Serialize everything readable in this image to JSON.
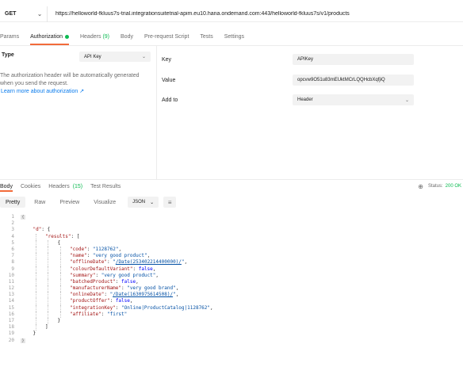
{
  "request": {
    "method": "GET",
    "url": "https://helloworld-fkluus7s-trial.integrationsuitetrial-apim.eu10.hana.ondemand.com:443/helloworld-fkluus7s/v1/products"
  },
  "request_tabs": [
    {
      "label": "Params"
    },
    {
      "label": "Authorization"
    },
    {
      "label": "Headers",
      "count": "(9)"
    },
    {
      "label": "Body"
    },
    {
      "label": "Pre-request Script"
    },
    {
      "label": "Tests"
    },
    {
      "label": "Settings"
    }
  ],
  "auth": {
    "type_label": "Type",
    "type_value": "API Key",
    "description": "The authorization header will be automatically generated when you send the request.",
    "learn_more": "Learn more about authorization ↗",
    "rows": [
      {
        "label": "Key",
        "value": "APIKey"
      },
      {
        "label": "Value",
        "value": "opcvw9O51u83mEUktMCrLQQHcbXqfjiQ"
      },
      {
        "label": "Add to",
        "value": "Header"
      }
    ]
  },
  "response_tabs": [
    {
      "label": "Body"
    },
    {
      "label": "Cookies"
    },
    {
      "label": "Headers",
      "count": "(15)"
    },
    {
      "label": "Test Results"
    }
  ],
  "status": {
    "label": "Status:",
    "value": "200 OK"
  },
  "toolbar": {
    "pretty": "Pretty",
    "raw": "Raw",
    "preview": "Preview",
    "visualize": "Visualize",
    "format": "JSON"
  },
  "icons": {
    "method_chevron": "chevron-down-icon",
    "globe": "globe-icon",
    "wrap": "wrap-lines-icon"
  },
  "colors": {
    "accent": "#f26b3a",
    "success": "#0cbb52",
    "link": "#097bed"
  },
  "code_lines": [
    {
      "n": "1",
      "i": 0,
      "parts": [
        {
          "t": "{",
          "c": "fold"
        }
      ]
    },
    {
      "n": "2",
      "i": 0,
      "parts": []
    },
    {
      "n": "3",
      "i": 1,
      "parts": [
        {
          "t": "\"d\"",
          "c": "k"
        },
        {
          "t": ": {",
          "c": "p"
        }
      ]
    },
    {
      "n": "4",
      "i": 2,
      "parts": [
        {
          "t": "\"results\"",
          "c": "k"
        },
        {
          "t": ": [",
          "c": "p"
        }
      ]
    },
    {
      "n": "5",
      "i": 3,
      "parts": [
        {
          "t": "{",
          "c": "p"
        }
      ]
    },
    {
      "n": "6",
      "i": 4,
      "parts": [
        {
          "t": "\"code\"",
          "c": "k"
        },
        {
          "t": ": ",
          "c": "p"
        },
        {
          "t": "\"1128762\"",
          "c": "s"
        },
        {
          "t": ",",
          "c": "p"
        }
      ]
    },
    {
      "n": "7",
      "i": 4,
      "parts": [
        {
          "t": "\"name\"",
          "c": "k"
        },
        {
          "t": ": ",
          "c": "p"
        },
        {
          "t": "\"very good product\"",
          "c": "s"
        },
        {
          "t": ",",
          "c": "p"
        }
      ]
    },
    {
      "n": "8",
      "i": 4,
      "parts": [
        {
          "t": "\"offlineDate\"",
          "c": "k"
        },
        {
          "t": ": ",
          "c": "p"
        },
        {
          "t": "\"",
          "c": "s"
        },
        {
          "t": "/Date(253402214400000)/",
          "c": "u"
        },
        {
          "t": "\"",
          "c": "s"
        },
        {
          "t": ",",
          "c": "p"
        }
      ]
    },
    {
      "n": "9",
      "i": 4,
      "parts": [
        {
          "t": "\"colourDefaultVariant\"",
          "c": "k"
        },
        {
          "t": ": ",
          "c": "p"
        },
        {
          "t": "false",
          "c": "b"
        },
        {
          "t": ",",
          "c": "p"
        }
      ]
    },
    {
      "n": "10",
      "i": 4,
      "parts": [
        {
          "t": "\"summary\"",
          "c": "k"
        },
        {
          "t": ": ",
          "c": "p"
        },
        {
          "t": "\"very good product\"",
          "c": "s"
        },
        {
          "t": ",",
          "c": "p"
        }
      ]
    },
    {
      "n": "11",
      "i": 4,
      "parts": [
        {
          "t": "\"batchedProduct\"",
          "c": "k"
        },
        {
          "t": ": ",
          "c": "p"
        },
        {
          "t": "false",
          "c": "b"
        },
        {
          "t": ",",
          "c": "p"
        }
      ]
    },
    {
      "n": "12",
      "i": 4,
      "parts": [
        {
          "t": "\"manufacturerName\"",
          "c": "k"
        },
        {
          "t": ": ",
          "c": "p"
        },
        {
          "t": "\"very good brand\"",
          "c": "s"
        },
        {
          "t": ",",
          "c": "p"
        }
      ]
    },
    {
      "n": "13",
      "i": 4,
      "parts": [
        {
          "t": "\"onlineDate\"",
          "c": "k"
        },
        {
          "t": ": ",
          "c": "p"
        },
        {
          "t": "\"",
          "c": "s"
        },
        {
          "t": "/Date(1630975614508)/",
          "c": "u"
        },
        {
          "t": "\"",
          "c": "s"
        },
        {
          "t": ",",
          "c": "p"
        }
      ]
    },
    {
      "n": "14",
      "i": 4,
      "parts": [
        {
          "t": "\"productOffer\"",
          "c": "k"
        },
        {
          "t": ": ",
          "c": "p"
        },
        {
          "t": "false",
          "c": "b"
        },
        {
          "t": ",",
          "c": "p"
        }
      ]
    },
    {
      "n": "15",
      "i": 4,
      "parts": [
        {
          "t": "\"integrationKey\"",
          "c": "k"
        },
        {
          "t": ": ",
          "c": "p"
        },
        {
          "t": "\"Online|ProductCatalog|1128762\"",
          "c": "s"
        },
        {
          "t": ",",
          "c": "p"
        }
      ]
    },
    {
      "n": "16",
      "i": 4,
      "parts": [
        {
          "t": "\"affiliate\"",
          "c": "k"
        },
        {
          "t": ": ",
          "c": "p"
        },
        {
          "t": "\"first\"",
          "c": "s"
        }
      ]
    },
    {
      "n": "17",
      "i": 3,
      "parts": [
        {
          "t": "}",
          "c": "p"
        }
      ]
    },
    {
      "n": "18",
      "i": 2,
      "parts": [
        {
          "t": "]",
          "c": "p"
        }
      ]
    },
    {
      "n": "19",
      "i": 1,
      "parts": [
        {
          "t": "}",
          "c": "p"
        }
      ]
    },
    {
      "n": "20",
      "i": 0,
      "parts": [
        {
          "t": "}",
          "c": "fold"
        }
      ]
    }
  ]
}
